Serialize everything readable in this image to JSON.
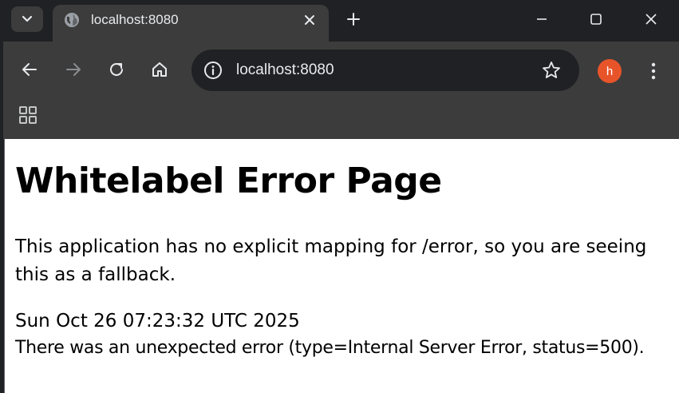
{
  "tab": {
    "title": "localhost:8080",
    "favicon": "globe-icon"
  },
  "omnibox": {
    "url": "localhost:8080"
  },
  "profile": {
    "initial": "h",
    "color": "#e8542a"
  },
  "page": {
    "heading": "Whitelabel Error Page",
    "message_line1": "This application has no explicit mapping for /error, so you are seeing",
    "message_line2": "this as a fallback.",
    "timestamp": "Sun Oct 26 07:23:32 UTC 2025",
    "error_detail": "There was an unexpected error (type=Internal Server Error, status=500)."
  },
  "colors": {
    "frame": "#202124",
    "toolbar": "#3c3c3c",
    "content_bg": "#ffffff",
    "text": "#e8eaed"
  }
}
